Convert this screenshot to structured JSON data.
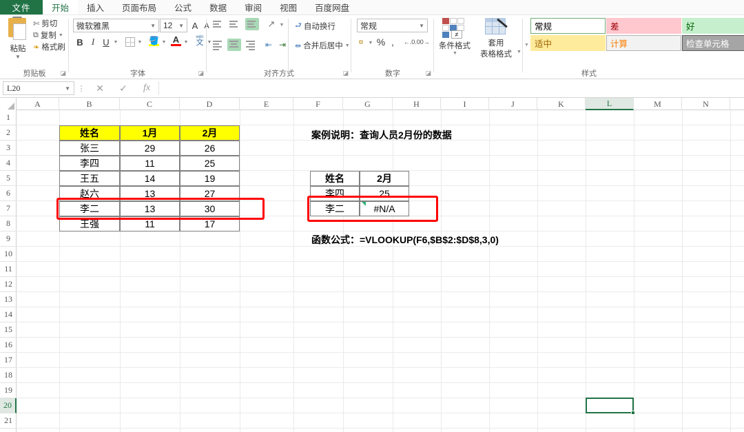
{
  "window": {
    "name_box_value": "L20",
    "formula_bar_value": "",
    "selected_cell": "L20",
    "selected_column": "L",
    "selected_row": "20"
  },
  "ribbon": {
    "tabs": [
      {
        "label": "文件",
        "active": false,
        "kind": "file"
      },
      {
        "label": "开始",
        "active": true
      },
      {
        "label": "插入",
        "active": false
      },
      {
        "label": "页面布局",
        "active": false
      },
      {
        "label": "公式",
        "active": false
      },
      {
        "label": "数据",
        "active": false
      },
      {
        "label": "审阅",
        "active": false
      },
      {
        "label": "视图",
        "active": false
      },
      {
        "label": "百度网盘",
        "active": false
      }
    ],
    "groups": [
      {
        "name": "clipboard",
        "label": "剪贴板"
      },
      {
        "name": "font",
        "label": "字体"
      },
      {
        "name": "alignment",
        "label": "对齐方式"
      },
      {
        "name": "number",
        "label": "数字"
      },
      {
        "name": "styles",
        "label": "样式"
      }
    ],
    "clipboard": {
      "paste_label": "粘贴",
      "cut_label": "剪切",
      "copy_label": "复制",
      "format_painter_label": "格式刷"
    },
    "font": {
      "font_name": "微软雅黑",
      "font_size": "12",
      "grow_font": "A",
      "shrink_font": "A",
      "bold": "B",
      "italic": "I",
      "underline": "U",
      "borders_icon": "borders-icon",
      "fill_color_icon": "fill-color-icon",
      "font_color_icon": "font-color-icon",
      "phonetic_icon": "phonetic-guide-icon",
      "phonetic_label": "文"
    },
    "alignment": {
      "wrap_text_label": "自动换行",
      "merge_center_label": "合并后居中",
      "orientation_icon": "orientation-icon",
      "decrease_indent_icon": "decrease-indent-icon",
      "increase_indent_icon": "increase-indent-icon"
    },
    "number": {
      "format_value": "常规",
      "accounting_icon": "accounting-format-icon",
      "percent_label": "%",
      "comma_label": ",",
      "increase_decimal_label": ".00",
      "decrease_decimal_label": ".00"
    },
    "styles": {
      "conditional_format_label": "条件格式",
      "format_as_table_label": "套用",
      "format_as_table_label2": "表格格式",
      "cells": [
        {
          "label": "常规",
          "bg": "#ffffff",
          "fg": "#000000",
          "border": "#70ad75"
        },
        {
          "label": "差",
          "bg": "#ffc7ce",
          "fg": "#9c0006",
          "border": "#ffc7ce"
        },
        {
          "label": "好",
          "bg": "#c6efce",
          "fg": "#006100",
          "border": "#c6efce"
        },
        {
          "label": "适中",
          "bg": "#ffeb9c",
          "fg": "#9c6500",
          "border": "#ffeb9c"
        },
        {
          "label": "计算",
          "bg": "#f2f2f2",
          "fg": "#fa7d00",
          "border": "#b3b3b3"
        },
        {
          "label": "检查单元格",
          "bg": "#a5a5a5",
          "fg": "#ffffff",
          "border": "#5a5a5a"
        }
      ]
    }
  },
  "sheet": {
    "columns": [
      "A",
      "B",
      "C",
      "D",
      "E",
      "F",
      "G",
      "H",
      "I",
      "J",
      "K",
      "L",
      "M",
      "N"
    ],
    "rows": [
      "1",
      "2",
      "3",
      "4",
      "5",
      "6",
      "7",
      "8",
      "9",
      "10",
      "11",
      "12",
      "13",
      "14",
      "15",
      "16",
      "17",
      "18",
      "19",
      "20",
      "21"
    ],
    "source_table": {
      "headers": [
        "姓名",
        "1月",
        "2月"
      ],
      "rows": [
        [
          "张三",
          "29",
          "26"
        ],
        [
          "李四",
          "11",
          "25"
        ],
        [
          "王五",
          "14",
          "19"
        ],
        [
          "赵六",
          "13",
          "27"
        ],
        [
          "李二",
          "13",
          "30"
        ],
        [
          "王强",
          "11",
          "17"
        ]
      ]
    },
    "案例说明": "案例说明：查询人员2月份的数据",
    "lookup_table": {
      "headers": [
        "姓名",
        "2月"
      ],
      "rows": [
        [
          "李四",
          "25"
        ],
        [
          "李二",
          "#N/A"
        ]
      ]
    },
    "formula_note": "函数公式：=VLOOKUP(F6,$B$2:$D$8,3,0)",
    "highlight_color": "#ff0000",
    "header_fill": "#ffff00"
  }
}
